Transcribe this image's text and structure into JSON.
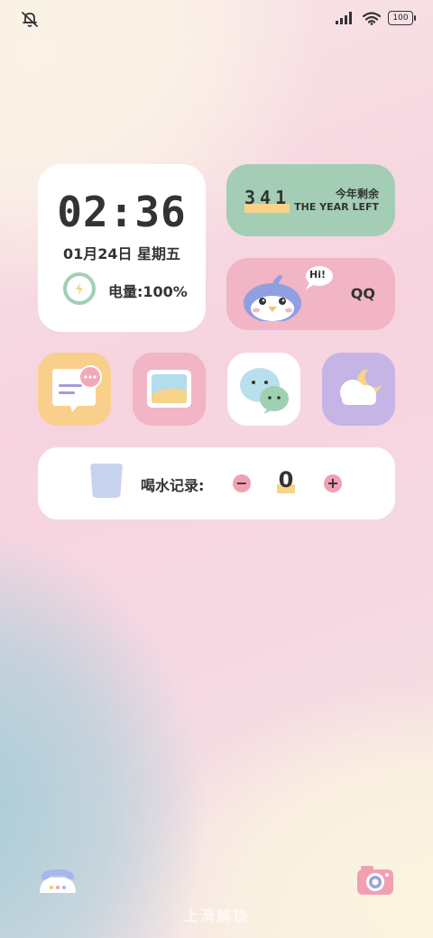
{
  "status": {
    "mute_icon": "bell-off-icon",
    "signal_icon": "cell-signal-icon",
    "wifi_icon": "wifi-icon",
    "battery_level": "100"
  },
  "clock": {
    "time": "02:36",
    "date": "01月24日 星期五",
    "battery_label": "电量:100%"
  },
  "year_widget": {
    "days_left": "341",
    "label_zh": "今年剩余",
    "label_en": "THE YEAR LEFT"
  },
  "qq_widget": {
    "bubble": "Hi!",
    "label": "QQ"
  },
  "apps": [
    {
      "name": "messages-app-icon",
      "bg": "#f9cf8c"
    },
    {
      "name": "gallery-app-icon",
      "bg": "#f1b5c5"
    },
    {
      "name": "wechat-app-icon",
      "bg": "#ffffff"
    },
    {
      "name": "weather-app-icon",
      "bg": "#c5b4e6"
    }
  ],
  "water": {
    "label": "喝水记录:",
    "minus": "−",
    "count": "0",
    "plus": "+"
  },
  "bottom": {
    "phone_icon": "phone-icon",
    "camera_icon": "camera-icon",
    "unlock_text": "上滑解锁"
  },
  "colors": {
    "green": "#a3cdb5",
    "pink": "#f1b5c5",
    "yellow": "#f7d488",
    "purple": "#c5b4e6"
  }
}
